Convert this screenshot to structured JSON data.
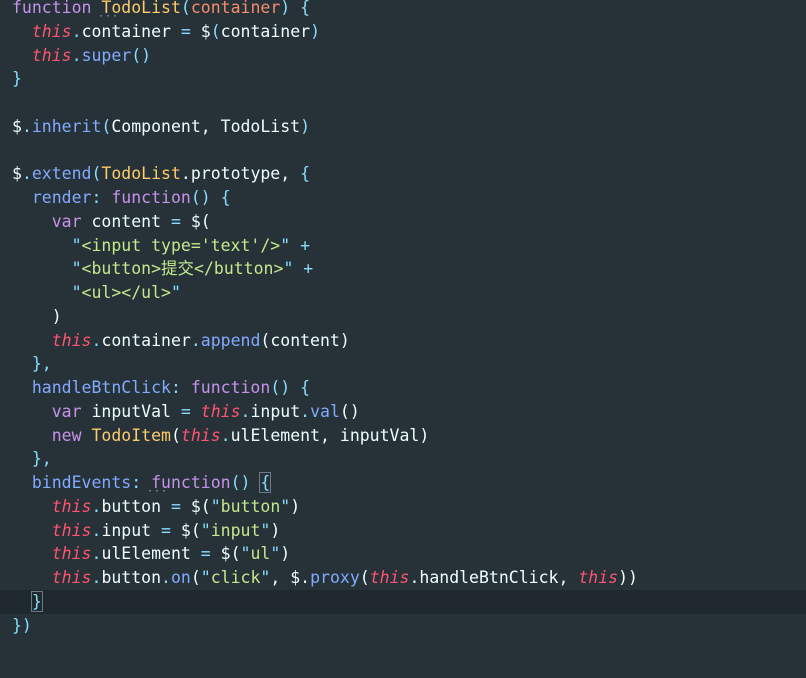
{
  "editor": {
    "lines": [
      [
        {
          "t": "function",
          "c": "kw"
        },
        {
          "t": " ",
          "c": "plain"
        },
        {
          "t": "TodoList",
          "c": "cls"
        },
        {
          "t": "(",
          "c": "punc"
        },
        {
          "t": "container",
          "c": "param"
        },
        {
          "t": ")",
          "c": "punc"
        },
        {
          "t": " {",
          "c": "punc"
        }
      ],
      [
        {
          "t": "  ",
          "c": "plain"
        },
        {
          "t": "this",
          "c": "this"
        },
        {
          "t": ".",
          "c": "punc"
        },
        {
          "t": "container",
          "c": "prop"
        },
        {
          "t": " = ",
          "c": "op"
        },
        {
          "t": "$",
          "c": "plain"
        },
        {
          "t": "(",
          "c": "punc"
        },
        {
          "t": "container",
          "c": "plain"
        },
        {
          "t": ")",
          "c": "punc"
        }
      ],
      [
        {
          "t": "  ",
          "c": "plain"
        },
        {
          "t": "this",
          "c": "this"
        },
        {
          "t": ".",
          "c": "punc"
        },
        {
          "t": "super",
          "c": "fn"
        },
        {
          "t": "()",
          "c": "punc"
        }
      ],
      [
        {
          "t": "}",
          "c": "punc"
        }
      ],
      [],
      [
        {
          "t": "$",
          "c": "plain"
        },
        {
          "t": ".",
          "c": "punc"
        },
        {
          "t": "inherit",
          "c": "fn"
        },
        {
          "t": "(",
          "c": "punc"
        },
        {
          "t": "Component, TodoList",
          "c": "plain"
        },
        {
          "t": ")",
          "c": "punc"
        }
      ],
      [],
      [
        {
          "t": "$",
          "c": "plain"
        },
        {
          "t": ".",
          "c": "punc"
        },
        {
          "t": "extend",
          "c": "fn"
        },
        {
          "t": "(",
          "c": "punc"
        },
        {
          "t": "TodoList",
          "c": "cls"
        },
        {
          "t": ".prototype, ",
          "c": "plain"
        },
        {
          "t": "{",
          "c": "punc"
        }
      ],
      [
        {
          "t": "  ",
          "c": "plain"
        },
        {
          "t": "render",
          "c": "fn"
        },
        {
          "t": ": ",
          "c": "punc"
        },
        {
          "t": "function",
          "c": "kw"
        },
        {
          "t": "() {",
          "c": "punc"
        }
      ],
      [
        {
          "t": "    ",
          "c": "plain"
        },
        {
          "t": "var",
          "c": "kw"
        },
        {
          "t": " content ",
          "c": "plain"
        },
        {
          "t": "=",
          "c": "op"
        },
        {
          "t": " $(",
          "c": "plain"
        }
      ],
      [
        {
          "t": "      ",
          "c": "plain"
        },
        {
          "t": "\"",
          "c": "punc"
        },
        {
          "t": "<input type='text'/>",
          "c": "str"
        },
        {
          "t": "\"",
          "c": "punc"
        },
        {
          "t": " +",
          "c": "op"
        }
      ],
      [
        {
          "t": "      ",
          "c": "plain"
        },
        {
          "t": "\"",
          "c": "punc"
        },
        {
          "t": "<button>提交</button>",
          "c": "str"
        },
        {
          "t": "\"",
          "c": "punc"
        },
        {
          "t": " +",
          "c": "op"
        }
      ],
      [
        {
          "t": "      ",
          "c": "plain"
        },
        {
          "t": "\"",
          "c": "punc"
        },
        {
          "t": "<ul></ul>",
          "c": "str"
        },
        {
          "t": "\"",
          "c": "punc"
        }
      ],
      [
        {
          "t": "    ",
          "c": "plain"
        },
        {
          "t": ")",
          "c": "plain"
        }
      ],
      [
        {
          "t": "    ",
          "c": "plain"
        },
        {
          "t": "this",
          "c": "this"
        },
        {
          "t": ".",
          "c": "punc"
        },
        {
          "t": "container",
          "c": "prop"
        },
        {
          "t": ".",
          "c": "punc"
        },
        {
          "t": "append",
          "c": "fn"
        },
        {
          "t": "(content)",
          "c": "plain"
        }
      ],
      [
        {
          "t": "  ",
          "c": "plain"
        },
        {
          "t": "},",
          "c": "punc"
        }
      ],
      [
        {
          "t": "  ",
          "c": "plain"
        },
        {
          "t": "handleBtnClick",
          "c": "fn"
        },
        {
          "t": ": ",
          "c": "punc"
        },
        {
          "t": "function",
          "c": "kw"
        },
        {
          "t": "() {",
          "c": "punc"
        }
      ],
      [
        {
          "t": "    ",
          "c": "plain"
        },
        {
          "t": "var",
          "c": "kw"
        },
        {
          "t": " inputVal ",
          "c": "plain"
        },
        {
          "t": "=",
          "c": "op"
        },
        {
          "t": " ",
          "c": "plain"
        },
        {
          "t": "this",
          "c": "this"
        },
        {
          "t": ".",
          "c": "punc"
        },
        {
          "t": "input",
          "c": "prop"
        },
        {
          "t": ".",
          "c": "punc"
        },
        {
          "t": "val",
          "c": "fn"
        },
        {
          "t": "()",
          "c": "plain"
        }
      ],
      [
        {
          "t": "    ",
          "c": "plain"
        },
        {
          "t": "new",
          "c": "kw"
        },
        {
          "t": " ",
          "c": "plain"
        },
        {
          "t": "TodoItem",
          "c": "cls"
        },
        {
          "t": "(",
          "c": "plain"
        },
        {
          "t": "this",
          "c": "this"
        },
        {
          "t": ".",
          "c": "punc"
        },
        {
          "t": "ulElement, inputVal)",
          "c": "plain"
        }
      ],
      [
        {
          "t": "  ",
          "c": "plain"
        },
        {
          "t": "},",
          "c": "punc"
        }
      ],
      [
        {
          "t": "  ",
          "c": "plain"
        },
        {
          "t": "bindEvents",
          "c": "fn"
        },
        {
          "t": ": ",
          "c": "punc"
        },
        {
          "t": "function",
          "c": "kw"
        },
        {
          "t": "() ",
          "c": "punc"
        },
        {
          "t": "{",
          "c": "punc box"
        }
      ],
      [
        {
          "t": "    ",
          "c": "plain"
        },
        {
          "t": "this",
          "c": "this"
        },
        {
          "t": ".",
          "c": "punc"
        },
        {
          "t": "button",
          "c": "prop"
        },
        {
          "t": " = ",
          "c": "op"
        },
        {
          "t": "$(",
          "c": "plain"
        },
        {
          "t": "\"",
          "c": "punc"
        },
        {
          "t": "button",
          "c": "str"
        },
        {
          "t": "\"",
          "c": "punc"
        },
        {
          "t": ")",
          "c": "plain"
        }
      ],
      [
        {
          "t": "    ",
          "c": "plain"
        },
        {
          "t": "this",
          "c": "this"
        },
        {
          "t": ".",
          "c": "punc"
        },
        {
          "t": "input",
          "c": "prop"
        },
        {
          "t": " = ",
          "c": "op"
        },
        {
          "t": "$(",
          "c": "plain"
        },
        {
          "t": "\"",
          "c": "punc"
        },
        {
          "t": "input",
          "c": "str"
        },
        {
          "t": "\"",
          "c": "punc"
        },
        {
          "t": ")",
          "c": "plain"
        }
      ],
      [
        {
          "t": "    ",
          "c": "plain"
        },
        {
          "t": "this",
          "c": "this"
        },
        {
          "t": ".",
          "c": "punc"
        },
        {
          "t": "ulElement",
          "c": "prop"
        },
        {
          "t": " = ",
          "c": "op"
        },
        {
          "t": "$(",
          "c": "plain"
        },
        {
          "t": "\"",
          "c": "punc"
        },
        {
          "t": "ul",
          "c": "str"
        },
        {
          "t": "\"",
          "c": "punc"
        },
        {
          "t": ")",
          "c": "plain"
        }
      ],
      [
        {
          "t": "    ",
          "c": "plain"
        },
        {
          "t": "this",
          "c": "this"
        },
        {
          "t": ".",
          "c": "punc"
        },
        {
          "t": "button",
          "c": "prop"
        },
        {
          "t": ".",
          "c": "punc"
        },
        {
          "t": "on",
          "c": "fn"
        },
        {
          "t": "(",
          "c": "plain"
        },
        {
          "t": "\"",
          "c": "punc"
        },
        {
          "t": "click",
          "c": "str"
        },
        {
          "t": "\"",
          "c": "punc"
        },
        {
          "t": ", $.",
          "c": "plain"
        },
        {
          "t": "proxy",
          "c": "fn"
        },
        {
          "t": "(",
          "c": "plain"
        },
        {
          "t": "this",
          "c": "this"
        },
        {
          "t": ".handleBtnClick, ",
          "c": "plain"
        },
        {
          "t": "this",
          "c": "this"
        },
        {
          "t": "))",
          "c": "plain"
        }
      ],
      [
        {
          "t": "  ",
          "c": "plain"
        },
        {
          "t": "}",
          "c": "punc box"
        }
      ],
      [
        {
          "t": "})",
          "c": "punc"
        }
      ]
    ],
    "active_line": 25,
    "theme": {
      "background": "#263238",
      "active_line": "#1f282d",
      "keyword": "#c792ea",
      "this": "#ff5370",
      "class": "#ffcb6b",
      "function": "#82aaff",
      "string": "#c3e88d",
      "operator": "#89ddff"
    }
  }
}
